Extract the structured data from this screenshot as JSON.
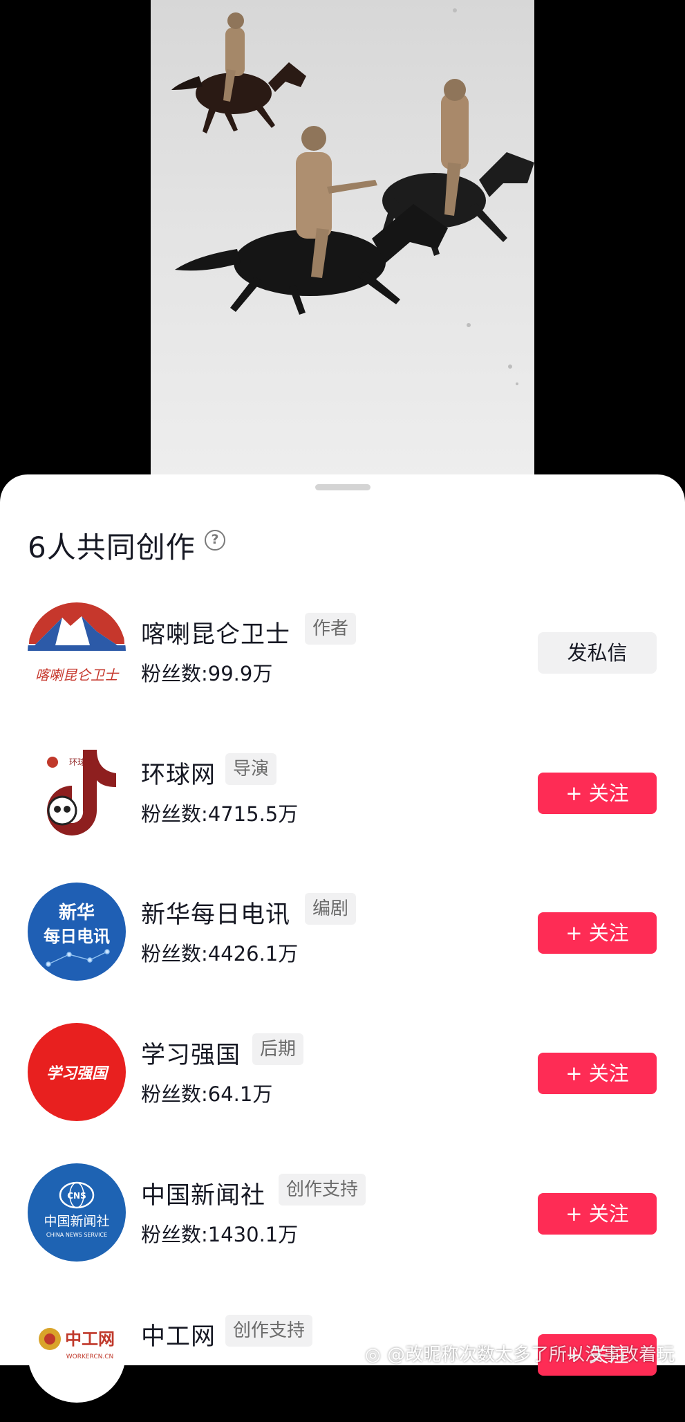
{
  "video": {
    "description_icon": "horse-riders-snow-video"
  },
  "sheet": {
    "title": "6人共同创作",
    "help_icon": "?"
  },
  "creators": [
    {
      "name": "喀喇昆仑卫士",
      "role": "作者",
      "fans": "粉丝数:99.9万",
      "action": "发私信",
      "avatar_text": "喀喇昆仑卫士"
    },
    {
      "name": "环球网",
      "role": "导演",
      "fans": "粉丝数:4715.5万",
      "action": "+ 关注",
      "avatar_text": "环球网"
    },
    {
      "name": "新华每日电讯",
      "role": "编剧",
      "fans": "粉丝数:4426.1万",
      "action": "+ 关注",
      "avatar_text_1": "新华",
      "avatar_text_2": "每日电讯"
    },
    {
      "name": "学习强国",
      "role": "后期",
      "fans": "粉丝数:64.1万",
      "action": "+ 关注",
      "avatar_text": "学习强国"
    },
    {
      "name": "中国新闻社",
      "role": "创作支持",
      "fans": "粉丝数:1430.1万",
      "action": "+ 关注",
      "avatar_text_1": "CNS",
      "avatar_text_2": "中国新闻社",
      "avatar_text_3": "CHINA NEWS SERVICE"
    },
    {
      "name": "中工网",
      "role": "创作支持",
      "fans": "",
      "action": "+ 关注",
      "avatar_text_1": "中工网",
      "avatar_text_2": "WORKERCN.CN"
    }
  ],
  "watermark": "@改昵称次数太多了所以没事改着玩",
  "colors": {
    "follow": "#fe2c55",
    "message_bg": "#f1f1f2",
    "text": "#161823"
  }
}
